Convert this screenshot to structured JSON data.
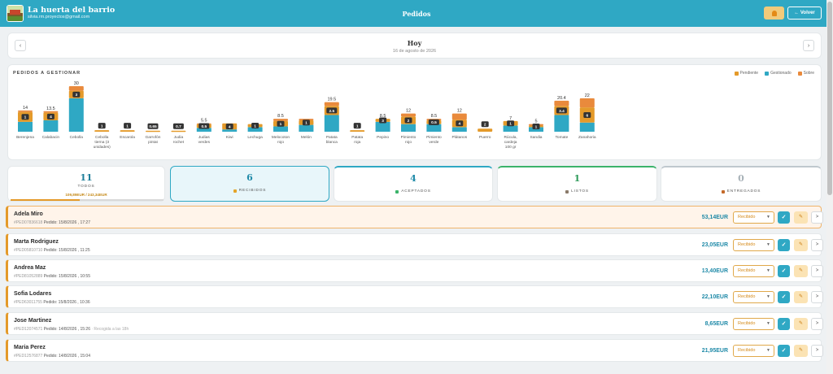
{
  "header": {
    "brand_name": "La huerta del barrio",
    "brand_email": "silvia.rm.proyectos@gmail.com",
    "title": "Pedidos",
    "back_label": "← Volver",
    "notifications_icon": "bell-icon"
  },
  "date_nav": {
    "prev_label": "‹",
    "next_label": "›",
    "day": "Hoy",
    "date": "16 de agosto de 2026"
  },
  "chart_data": {
    "type": "bar",
    "title": "PEDIDOS A GESTIONAR",
    "legend": [
      {
        "name": "Pendiente",
        "color": "#e49a2a"
      },
      {
        "name": "Gestionado",
        "color": "#2fa8c4"
      },
      {
        "name": "Sobre",
        "color": "#e98a3c"
      }
    ],
    "categories": [
      "Berenjena",
      "Calabacin",
      "Cebolla",
      "Cebolla tierna (3 unidades)",
      "Escarola",
      "Garrofon pintat",
      "Judia rochet",
      "Judias verdes",
      "Kiwi",
      "Lechuga",
      "Melocoton rojo",
      "Melon",
      "Patata blanca",
      "Patata roja",
      "Pepino",
      "Pimiento rojo",
      "Pimiento verde",
      "Platanos",
      "Puerro",
      "Rucula, cardeja 100 gr",
      "Sandia",
      "Tomate",
      "Zanahoria"
    ],
    "category_labels": [
      "Berenjena",
      "Calabacin",
      "Cebolla",
      "Cebolla tierna (3 unidades)",
      "Escarola",
      "Garrofón pintat",
      "Judia rochet",
      "Judias verdes",
      "Kiwi",
      "Lechuga",
      "Melocoton rojo",
      "Melón",
      "Patata blanca",
      "Patata roja",
      "Pepino",
      "Pimiento rojo",
      "Pimiento verde",
      "Plátanos",
      "Puerro",
      "Rúcula, cardeja 100 gr",
      "Sandia",
      "Tomate",
      "Zanahoria"
    ],
    "totals": [
      14,
      13.5,
      30,
      null,
      null,
      null,
      null,
      5.5,
      null,
      null,
      8.5,
      null,
      19.5,
      null,
      8.5,
      12,
      8.5,
      12,
      null,
      7,
      5,
      20.4,
      22
    ],
    "total_labels": [
      "14",
      "13.5",
      "30",
      "",
      "",
      "",
      "",
      "5.5",
      "",
      "",
      "8.5",
      "",
      "19.5",
      "",
      "8.5",
      "12",
      "8.5",
      "12",
      "",
      "7",
      "5",
      "20.4",
      "22"
    ],
    "pendiente": [
      6.5,
      5,
      5,
      1,
      1,
      0.65,
      0.7,
      2.5,
      4,
      2,
      3.5,
      3,
      6,
      1,
      2,
      5,
      2.5,
      5,
      2,
      3,
      1,
      6,
      10
    ],
    "gestionado": [
      6.5,
      7.5,
      22,
      0,
      0,
      0,
      0,
      2.5,
      1.5,
      3,
      3.5,
      4.5,
      11,
      0,
      6.5,
      5,
      5,
      3,
      0,
      4,
      3,
      11,
      6
    ],
    "sobre": [
      1,
      1,
      3,
      0,
      0,
      0,
      0,
      0.5,
      0,
      0,
      1.5,
      1,
      2.5,
      0,
      0,
      2,
      1,
      4,
      0,
      0,
      1,
      3.4,
      6
    ],
    "badges": [
      "1",
      "4",
      "3",
      "1",
      "1",
      "0.65",
      "0.7",
      "0.5",
      "4",
      "1",
      "1",
      "1",
      "2.5",
      "1",
      "3",
      "2",
      "0.5",
      "4",
      "2",
      "1",
      "1",
      "3.4",
      "6"
    ],
    "ylim": [
      0,
      32
    ]
  },
  "status_tiles": {
    "all": {
      "count": "11",
      "label": "TODOS",
      "amount": "109,89EUR / 243,34EUR",
      "progress": 0.45
    },
    "received": {
      "count": "6",
      "label": "RECIBIDOS"
    },
    "accepted": {
      "count": "4",
      "label": "ACEPTADOS"
    },
    "ready": {
      "count": "1",
      "label": "LISTOS"
    },
    "delivered": {
      "count": "0",
      "label": "ENTREGADOS"
    }
  },
  "order_actions": {
    "status_option": "Recibido",
    "confirm_label": "✓",
    "edit_label": "✎",
    "more_label": ">"
  },
  "orders": [
    {
      "name": "Adela Miro",
      "id": "#PED07836618",
      "meta": "Pedido: 15/8/2026 , 17:27",
      "note": "",
      "price": "53,14EUR"
    },
    {
      "name": "Marta Rodriguez",
      "id": "#PED05810710",
      "meta": "Pedido: 15/8/2026 , 11:25",
      "note": "",
      "price": "23,05EUR"
    },
    {
      "name": "Andrea Maz",
      "id": "#PED81052889",
      "meta": "Pedido: 15/8/2026 , 10:55",
      "note": "",
      "price": "13,40EUR"
    },
    {
      "name": "Sofia Lodares",
      "id": "#PED63011755",
      "meta": "Pedido: 15/8/2026 , 10:36",
      "note": "",
      "price": "22,10EUR"
    },
    {
      "name": "Jose Martinez",
      "id": "#PED12074571",
      "meta": "Pedido: 14/8/2026 , 15:26",
      "note": "· Recogida a las 18h",
      "price": "8,65EUR"
    },
    {
      "name": "Maria Perez",
      "id": "#PED12576877",
      "meta": "Pedido: 14/8/2026 , 15:04",
      "note": "",
      "price": "21,95EUR"
    }
  ]
}
